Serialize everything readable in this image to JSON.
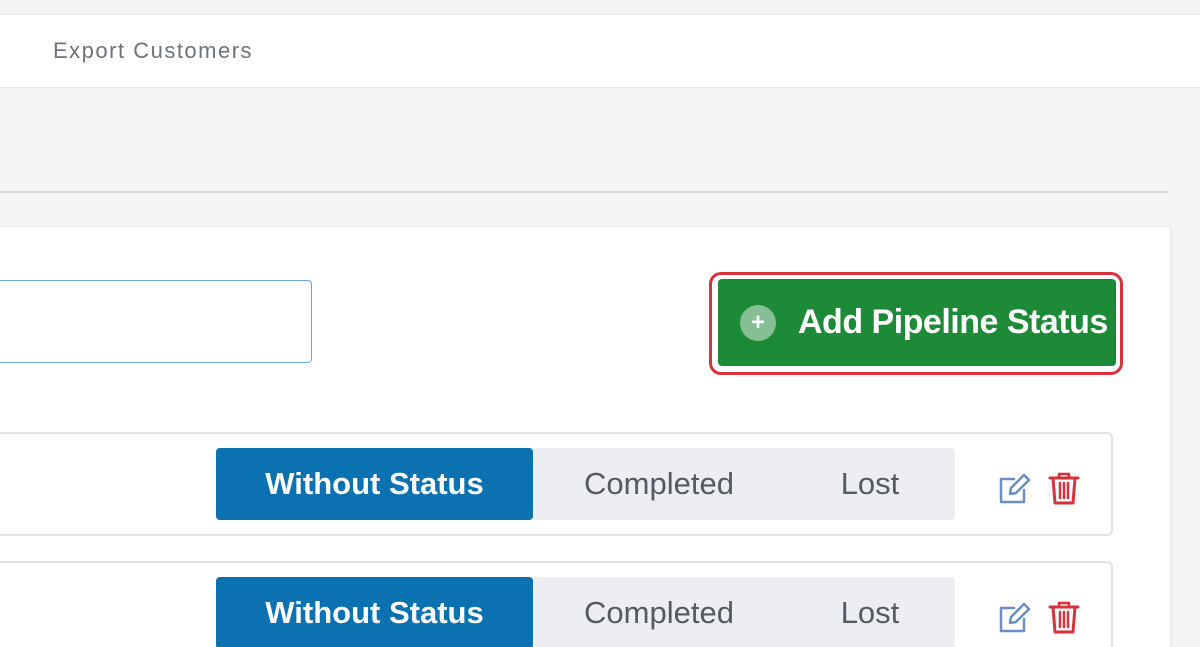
{
  "header": {
    "export_label": "Export Customers"
  },
  "toolbar": {
    "search_value": "",
    "add_button_label": "Add Pipeline Status",
    "add_icon_glyph": "+"
  },
  "rows": [
    {
      "statuses": [
        "Without Status",
        "Completed",
        "Lost"
      ],
      "active_status": "Without Status"
    },
    {
      "statuses": [
        "Without Status",
        "Completed",
        "Lost"
      ],
      "active_status": "Without Status"
    }
  ],
  "colors": {
    "add_button": "#1c8a36",
    "highlight_border": "#d8323c",
    "active_segment": "#0b71b0",
    "delete_icon": "#d8323c",
    "edit_icon": "#6b8fc4"
  },
  "icons": {
    "add": "plus-circle-icon",
    "edit": "edit-icon",
    "delete": "trash-icon"
  }
}
